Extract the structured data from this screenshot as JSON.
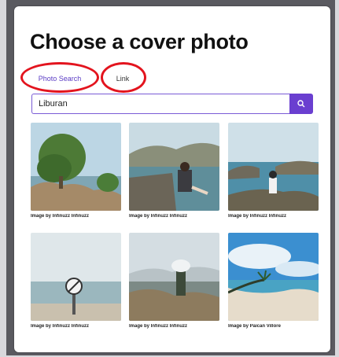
{
  "dialog": {
    "title": "Choose a cover photo",
    "tabs": [
      {
        "label": "Photo Search"
      },
      {
        "label": "Link"
      }
    ],
    "search": {
      "value": "Liburan",
      "icon": "search-icon"
    },
    "photos": [
      {
        "credit": "Image by Infinuzz Infinuzz",
        "scene": "tree on rocks by the sea"
      },
      {
        "credit": "Image by Infinuzz Infinuzz",
        "scene": "woman sitting on pier by bay"
      },
      {
        "credit": "Image by Infinuzz Infinuzz",
        "scene": "man on rock by the sea"
      },
      {
        "credit": "Image by Infinuzz Infinuzz",
        "scene": "no-entry sign on beach"
      },
      {
        "credit": "Image by Infinuzz Infinuzz",
        "scene": "waves crashing on rocks"
      },
      {
        "credit": "Image by Paican Villore",
        "scene": "tropical beach with blue sky"
      }
    ]
  },
  "colors": {
    "accent": "#6a3fd0",
    "annotation_ring": "#e3141e"
  }
}
